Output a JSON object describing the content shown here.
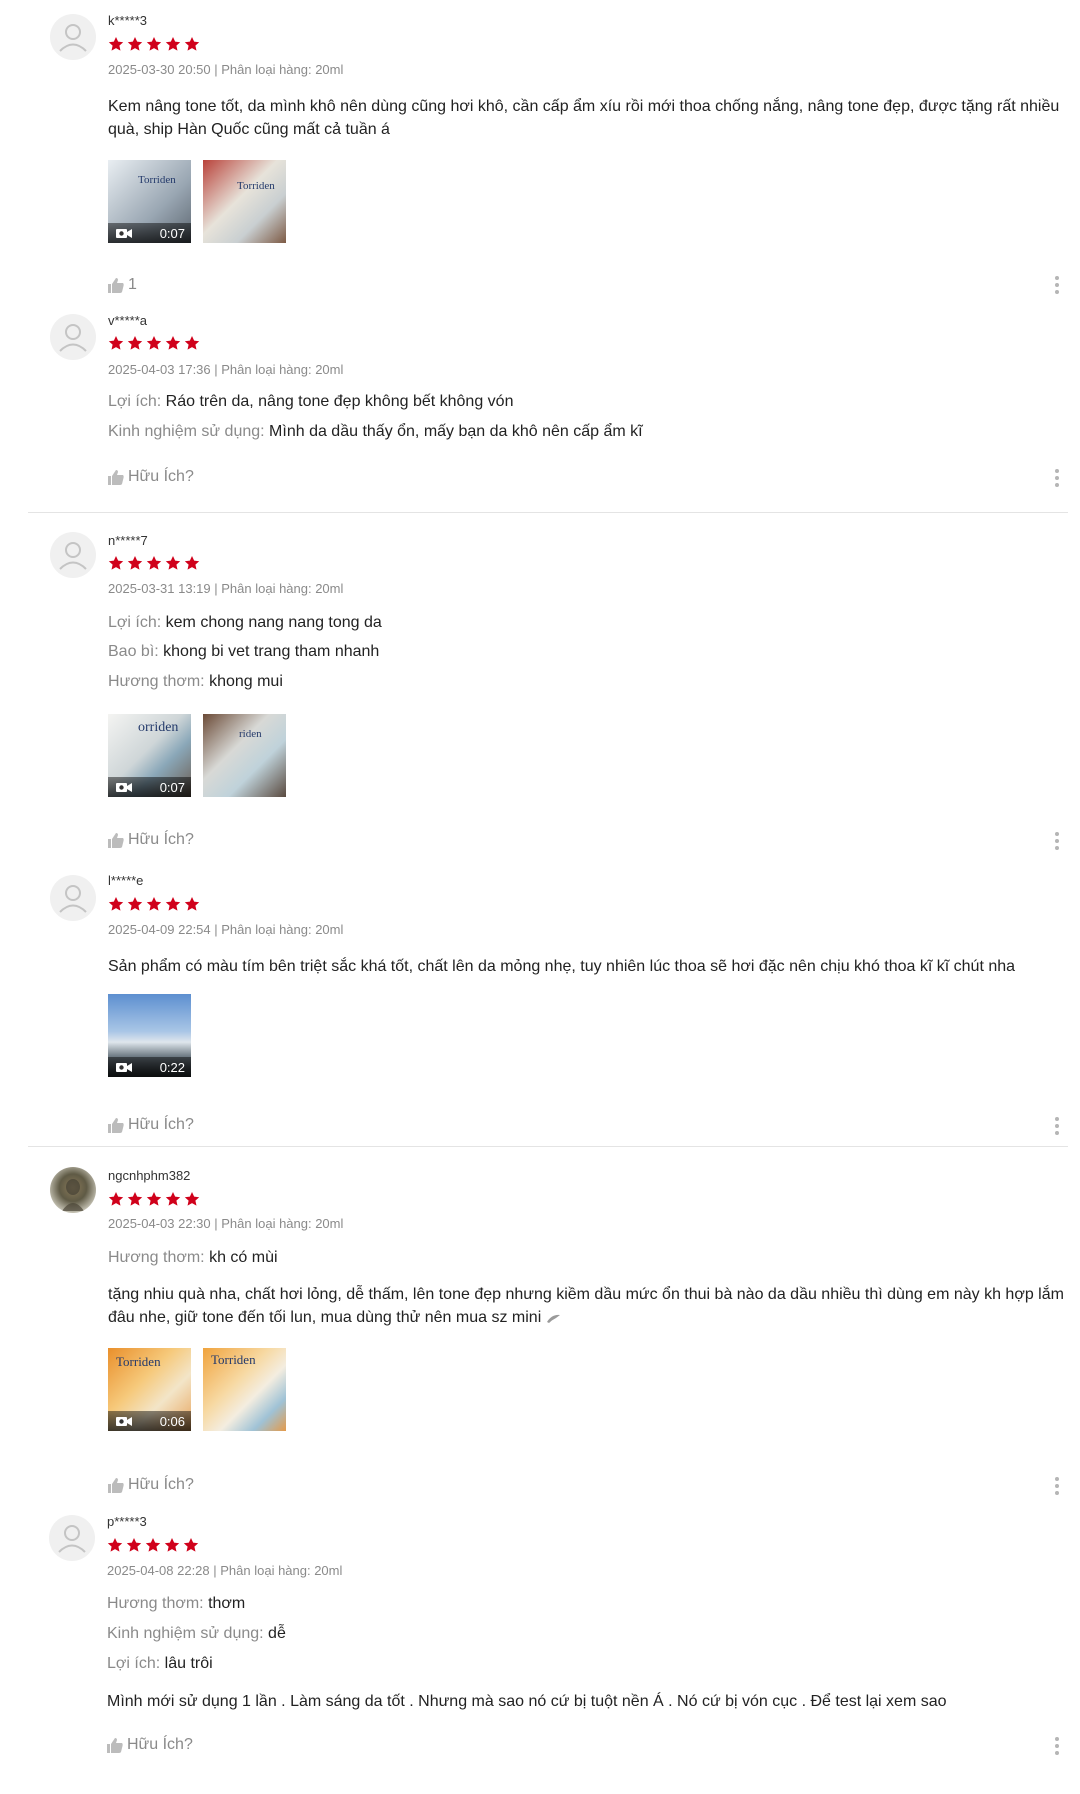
{
  "reviews": [
    {
      "username": "k*****3",
      "rating": 5,
      "meta": "2025-03-30 20:50 | Phân loại hàng: 20ml",
      "attributes": [],
      "text": "Kem nâng tone tốt, da mình khô nên dùng cũng hơi khô, cần cấp ẩm xíu rồi mới thoa chống nắng, nâng tone đẹp, được tặng rất nhiều quà, ship Hàn Quốc cũng mất cả tuần á",
      "media": [
        {
          "type": "video",
          "duration": "0:07",
          "label": "Torriden"
        },
        {
          "type": "image",
          "label": "Torriden"
        }
      ],
      "like_label": "1"
    },
    {
      "username": "v*****a",
      "rating": 5,
      "meta": "2025-04-03 17:36 | Phân loại hàng: 20ml",
      "attributes": [
        {
          "key": "Lợi ích:",
          "value": "Ráo trên da, nâng tone đẹp không bết không vón"
        },
        {
          "key": "Kinh nghiệm sử dụng:",
          "value": "Mình da dầu thấy ổn, mấy bạn da khô nên cấp ẩm kĩ"
        }
      ],
      "text": "",
      "media": [],
      "like_label": "Hữu Ích?"
    },
    {
      "username": "n*****7",
      "rating": 5,
      "meta": "2025-03-31 13:19 | Phân loại hàng: 20ml",
      "attributes": [
        {
          "key": "Lợi ích:",
          "value": "kem chong nang nang tong da"
        },
        {
          "key": "Bao bì:",
          "value": "khong bi vet trang tham nhanh"
        },
        {
          "key": "Hương thơm:",
          "value": "khong mui"
        }
      ],
      "text": "",
      "media": [
        {
          "type": "video",
          "duration": "0:07",
          "label": "orriden"
        },
        {
          "type": "image",
          "label": "riden"
        }
      ],
      "like_label": "Hữu Ích?"
    },
    {
      "username": "l*****e",
      "rating": 5,
      "meta": "2025-04-09 22:54 | Phân loại hàng: 20ml",
      "attributes": [],
      "text": "Sản phẩm có màu tím bên triệt sắc khá tốt, chất lên da mỏng nhẹ, tuy nhiên lúc thoa sẽ hơi đặc nên chịu khó thoa kĩ kĩ chút nha",
      "media": [
        {
          "type": "video",
          "duration": "0:22",
          "label": ""
        }
      ],
      "like_label": "Hữu Ích?"
    },
    {
      "username": "ngcnhphm382",
      "rating": 5,
      "meta": "2025-04-03 22:30 | Phân loại hàng: 20ml",
      "attributes": [
        {
          "key": "Hương thơm:",
          "value": "kh có mùi"
        }
      ],
      "text": "tặng nhiu quà nha, chất hơi lỏng, dễ thấm, lên tone đẹp nhưng kiềm dầu mức ổn thui bà nào da dầu nhiều thì dùng em này kh hợp lắm đâu nhe, giữ tone đến tối lun, mua dùng thử nên mua sz mini",
      "media": [
        {
          "type": "video",
          "duration": "0:06",
          "label": "Torriden"
        },
        {
          "type": "image",
          "label": "Torriden"
        }
      ],
      "like_label": "Hữu Ích?"
    },
    {
      "username": "p*****3",
      "rating": 5,
      "meta": "2025-04-08 22:28 | Phân loại hàng: 20ml",
      "attributes": [
        {
          "key": "Hương thơm:",
          "value": "thơm"
        },
        {
          "key": "Kinh nghiệm sử dụng:",
          "value": "dễ"
        },
        {
          "key": "Lợi ích:",
          "value": "lâu trôi"
        }
      ],
      "text": "Mình mới sử dụng 1 lần . Làm sáng da tốt . Nhưng mà sao nó cứ bị tuột nền Á . Nó cứ bị vón cục . Để test lại xem sao",
      "media": [],
      "like_label": "Hữu Ích?"
    }
  ],
  "colors": {
    "star": "#d0011b",
    "muted": "#8a8a8a",
    "text": "#222222",
    "divider": "#e4e4e4"
  }
}
